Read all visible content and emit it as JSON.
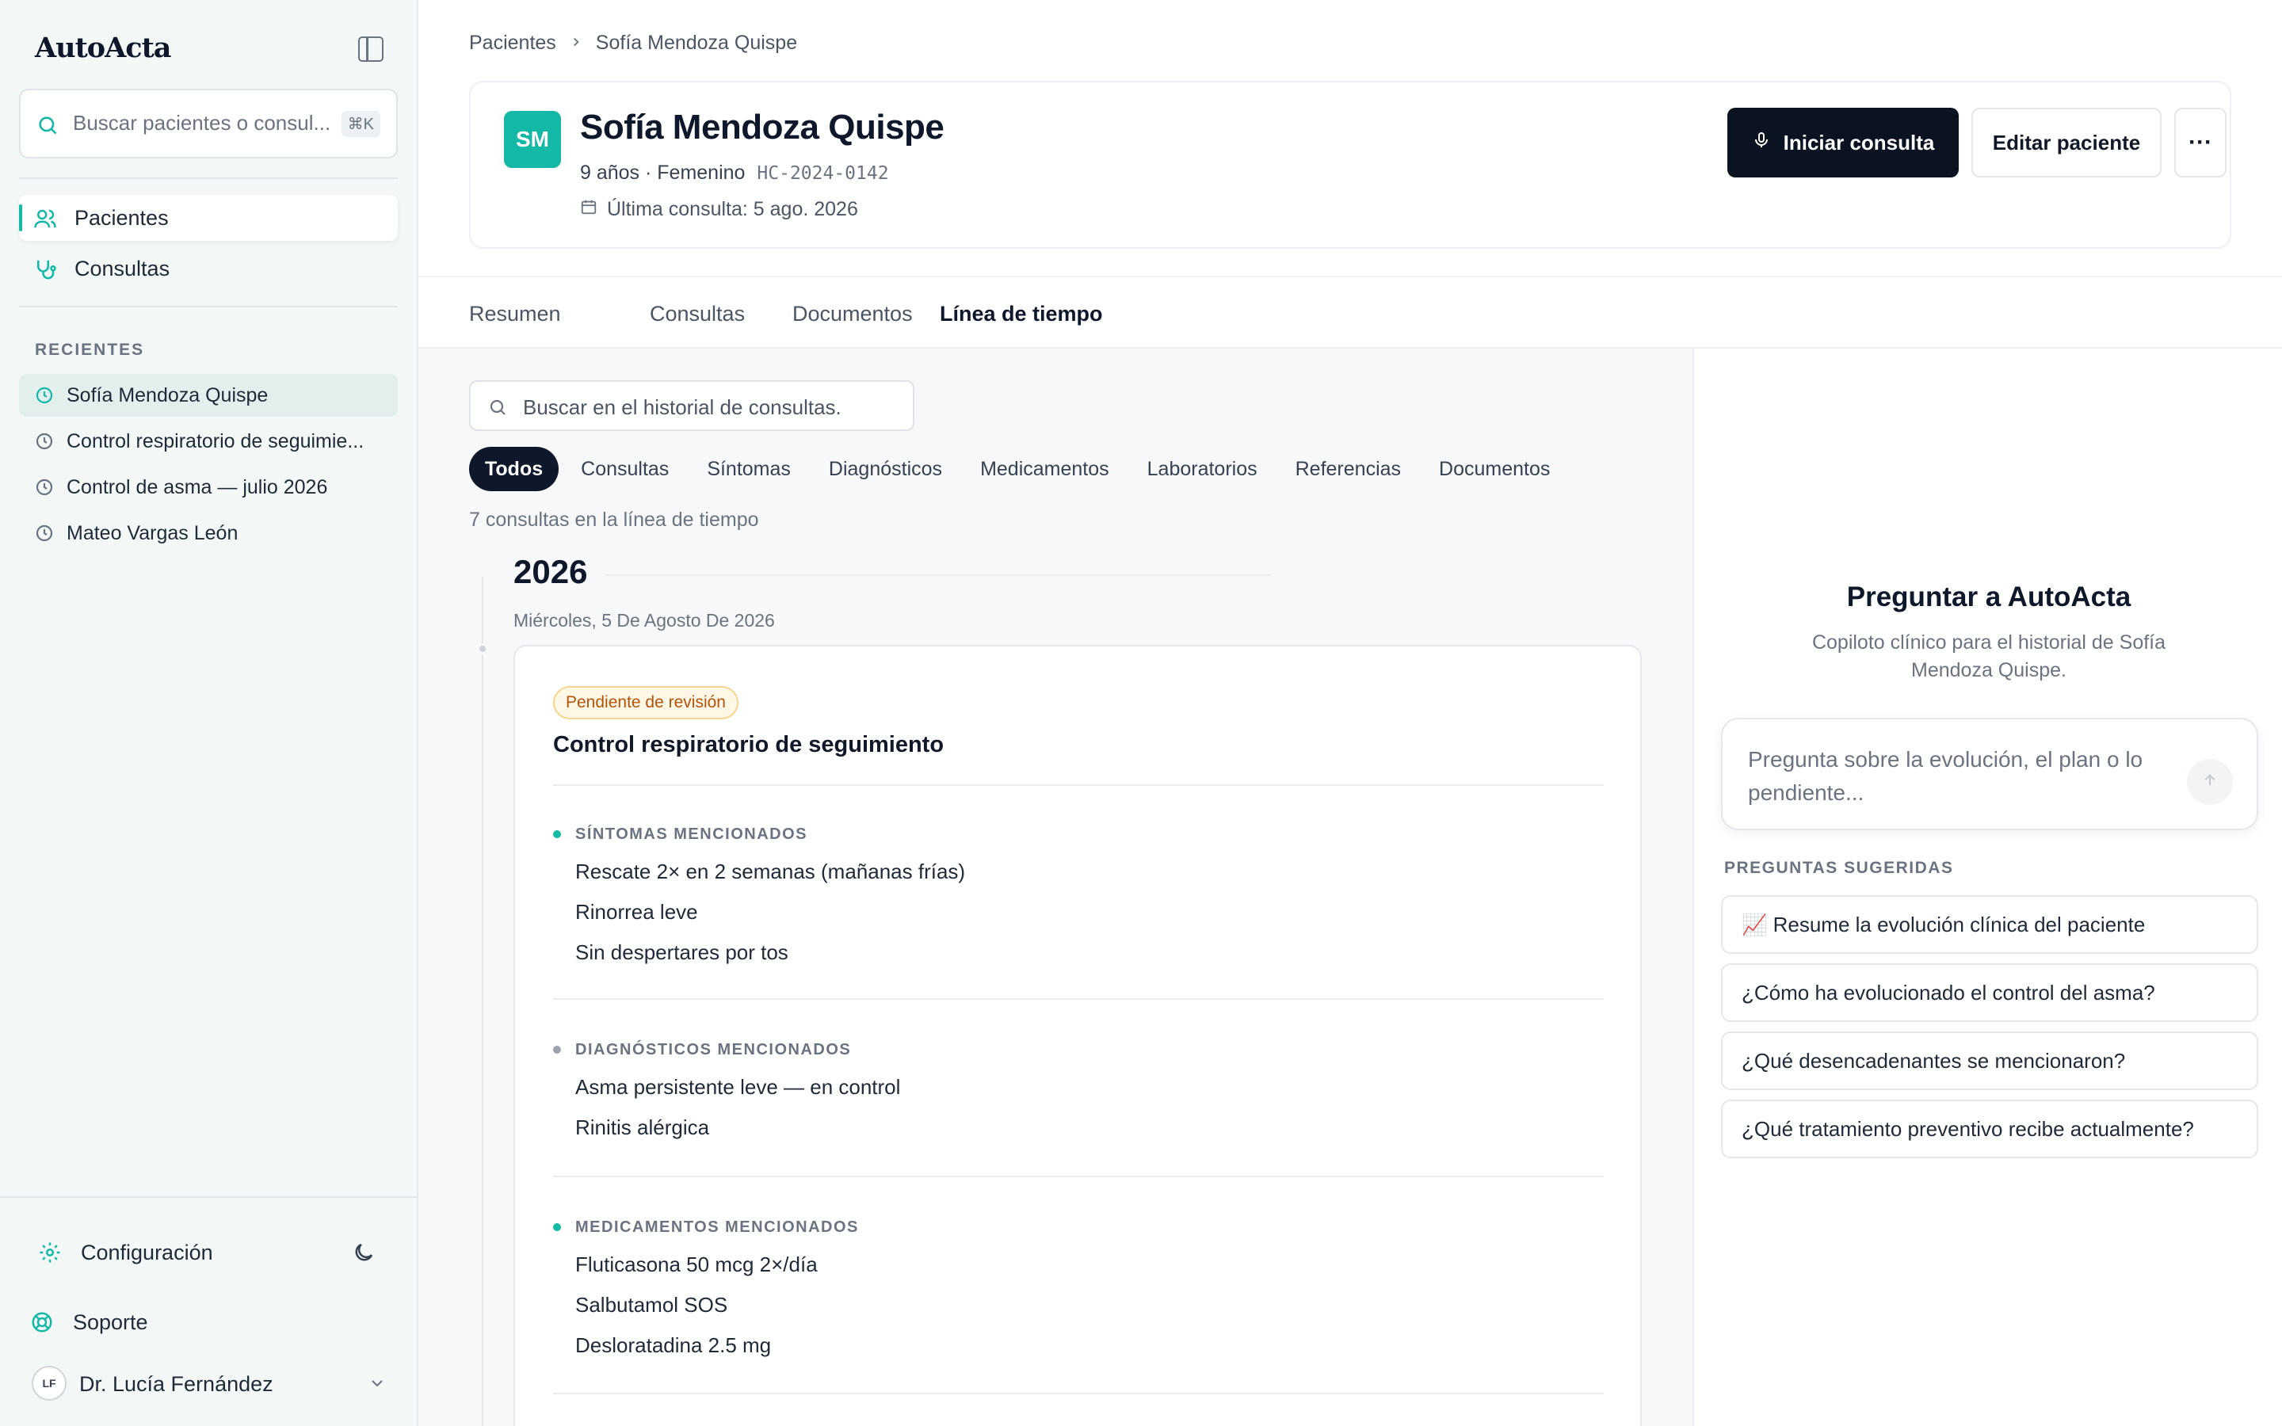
{
  "app": {
    "title": "AutoActa"
  },
  "sidebar": {
    "search_placeholder": "Buscar pacientes o consul...",
    "search_kbd": "⌘K",
    "nav": [
      {
        "label": "Pacientes",
        "active": true
      },
      {
        "label": "Consultas",
        "active": false
      }
    ],
    "recent_title": "RECIENTES",
    "recent": [
      {
        "label": "Sofía Mendoza Quispe",
        "active": true
      },
      {
        "label": "Control respiratorio de seguimie...",
        "active": false
      },
      {
        "label": "Control de asma — julio 2026",
        "active": false
      },
      {
        "label": "Mateo Vargas León",
        "active": false
      }
    ],
    "settings_label": "Configuración",
    "support_label": "Soporte",
    "user": {
      "initials": "LF",
      "name": "Dr. Lucía Fernández"
    }
  },
  "breadcrumb": {
    "root": "Pacientes",
    "current": "Sofía Mendoza Quispe"
  },
  "patient": {
    "initials": "SM",
    "name": "Sofía Mendoza Quispe",
    "meta": "9 años · Femenino",
    "record_id": "HC-2024-0142",
    "last_visit": "Última consulta: 5 ago. 2026"
  },
  "actions": {
    "start_label": "Iniciar consulta",
    "edit_label": "Editar paciente",
    "more_label": "···"
  },
  "tabs": [
    {
      "label": "Resumen",
      "active": false
    },
    {
      "label": "Consultas",
      "active": false
    },
    {
      "label": "Documentos",
      "active": false
    },
    {
      "label": "Línea de tiempo",
      "active": true
    }
  ],
  "timeline": {
    "search_placeholder": "Buscar en el historial de consultas.",
    "filters": [
      "Todos",
      "Consultas",
      "Síntomas",
      "Diagnósticos",
      "Medicamentos",
      "Laboratorios",
      "Referencias",
      "Documentos"
    ],
    "active_filter": "Todos",
    "count_text": "7 consultas en la línea de tiempo",
    "year": "2026",
    "date": "Miércoles, 5 De Agosto De 2026",
    "consult": {
      "status": "Pendiente de revisión",
      "title": "Control respiratorio de seguimiento",
      "sections": [
        {
          "title": "SÍNTOMAS MENCIONADOS",
          "color": "#14b8a6",
          "items": [
            "Rescate 2× en 2 semanas (mañanas frías)",
            "Rinorrea leve",
            "Sin despertares por tos"
          ]
        },
        {
          "title": "DIAGNÓSTICOS MENCIONADOS",
          "color": "#9ca3af",
          "items": [
            "Asma persistente leve — en control",
            "Rinitis alérgica"
          ]
        },
        {
          "title": "MEDICAMENTOS MENCIONADOS",
          "color": "#14b8a6",
          "items": [
            "Fluticasona 50 mcg 2×/día",
            "Salbutamol SOS",
            "Desloratadina 2.5 mg"
          ]
        }
      ]
    }
  },
  "assistant": {
    "title": "Preguntar a AutoActa",
    "subtitle": "Copiloto clínico para el historial de Sofía Mendoza Quispe.",
    "input_placeholder": "Pregunta sobre la evolución, el plan o lo pendiente...",
    "suggestions_title": "PREGUNTAS SUGERIDAS",
    "suggestions": [
      "📈  Resume la evolución clínica del paciente",
      "¿Cómo ha evolucionado el control del asma?",
      "¿Qué desencadenantes se mencionaron?",
      "¿Qué tratamiento preventivo recibe actualmente?"
    ]
  },
  "colors": {
    "accent": "#14b8a6",
    "primary": "#0b1220",
    "badge_text": "#b45309",
    "badge_bg": "#fff7e6"
  }
}
